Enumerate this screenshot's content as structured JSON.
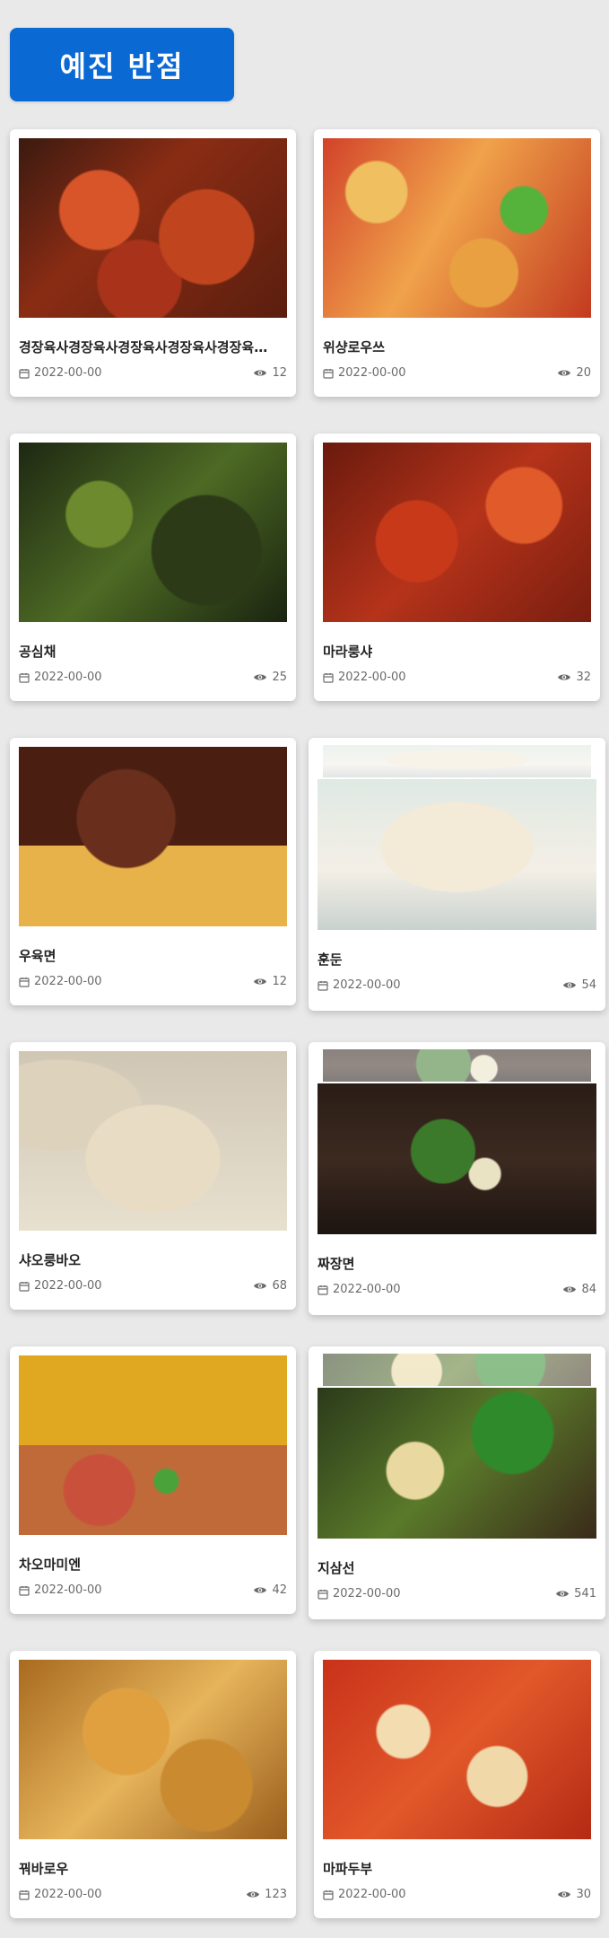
{
  "header": {
    "title": "예진 반점"
  },
  "colors": {
    "accent": "#0b69d4",
    "text": "#222222",
    "muted": "#6a6a6a"
  },
  "icons": {
    "date": "calendar-icon",
    "views": "eye-icon"
  },
  "items": [
    {
      "name": "경장육사경장육사경장육사경장육사경장육사경장육사",
      "date": "2022-00-00",
      "views": "12"
    },
    {
      "name": "위샹로우쓰",
      "date": "2022-00-00",
      "views": "20"
    },
    {
      "name": "공심채",
      "date": "2022-00-00",
      "views": "25"
    },
    {
      "name": "마라룽샤",
      "date": "2022-00-00",
      "views": "32"
    },
    {
      "name": "우육면",
      "date": "2022-00-00",
      "views": "12"
    },
    {
      "name": "훈둔",
      "date": "2022-00-00",
      "views": "54"
    },
    {
      "name": "샤오룽바오",
      "date": "2022-00-00",
      "views": "68"
    },
    {
      "name": "짜장면",
      "date": "2022-00-00",
      "views": "84"
    },
    {
      "name": "차오마미엔",
      "date": "2022-00-00",
      "views": "42"
    },
    {
      "name": "지삼선",
      "date": "2022-00-00",
      "views": "541"
    },
    {
      "name": "꿔바로우",
      "date": "2022-00-00",
      "views": "123"
    },
    {
      "name": "마파두부",
      "date": "2022-00-00",
      "views": "30"
    }
  ]
}
